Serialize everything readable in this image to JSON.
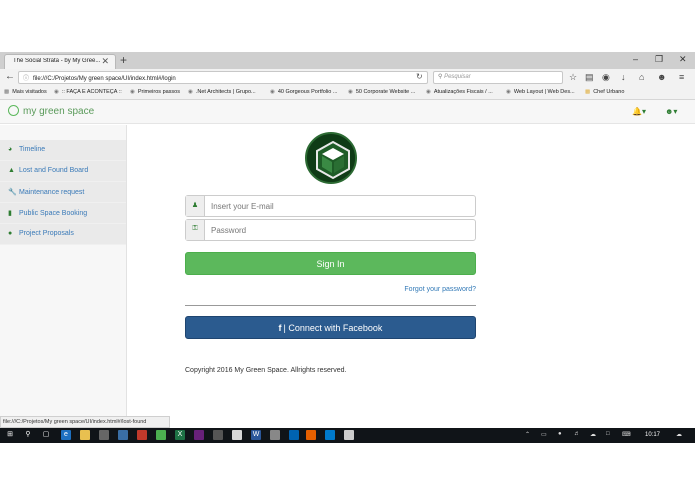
{
  "browser": {
    "tab_title": "The Social Strata - by My Gree...",
    "tab_close_glyph": "✕",
    "new_tab_glyph": "+",
    "window_controls": [
      "–",
      "❐",
      "✕"
    ],
    "url": "file:///C:/Projetos/My green space/UI/index.html#/login",
    "search_placeholder": "Pesquisar",
    "toolbar_icons": [
      "star-icon",
      "clipboard-icon",
      "pocket-icon",
      "download-icon",
      "home-icon",
      "extension-icon",
      "menu-icon"
    ],
    "bookmarks": [
      "Mais visitados",
      ":: FAÇA E ACONTEÇA ::",
      "Primeiros passos",
      ".Net Architects | Grupo...",
      "40 Gorgeous Portfolio ...",
      "50 Corporate Website ...",
      "Atualizações Fiscais / ...",
      "Web Layout | Web Des...",
      "Chef Urbano"
    ],
    "status_url": "file:///C:/Projetos/My green space/UI/index.html#/lost-found"
  },
  "app": {
    "brand": "my green space",
    "sidebar": {
      "items": [
        {
          "label": "Timeline",
          "icon": "dashboard-icon"
        },
        {
          "label": "Lost and Found Board",
          "icon": "binoculars-icon"
        },
        {
          "label": "Maintenance request",
          "icon": "wrench-icon"
        },
        {
          "label": "Public Space Booking",
          "icon": "bookmark-icon"
        },
        {
          "label": "Project Proposals",
          "icon": "globe-icon"
        }
      ]
    },
    "login": {
      "email_placeholder": "Insert your E-mail",
      "password_placeholder": "Password",
      "signin_label": "Sign In",
      "forgot_label": "Forgot your password?",
      "facebook_label": "| Connect with Facebook",
      "facebook_glyph": "f"
    },
    "footer": {
      "copyright": "Copyright 2016 My Green Space. Allrights reserved."
    },
    "colors": {
      "accent_green": "#5cb85c",
      "facebook_blue": "#2b5b8f",
      "link_blue": "#337ab7"
    }
  },
  "taskbar": {
    "clock": "10:17"
  }
}
